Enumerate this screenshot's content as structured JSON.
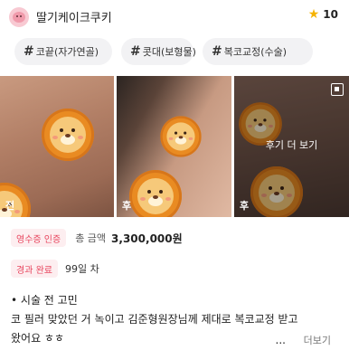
{
  "header": {
    "username": "딸기케이크쿠키",
    "rating": "10",
    "star_icon": "star-icon",
    "avatar_icon": "strawberry-cake-avatar-icon"
  },
  "tags": [
    {
      "hash": "#",
      "label": "코끝(자가연골)"
    },
    {
      "hash": "#",
      "label": "콧대(보형물)"
    },
    {
      "hash": "#",
      "label": "복코교정(수술)"
    }
  ],
  "photos": [
    {
      "label": "전",
      "sticker": "lion-sticker-icon"
    },
    {
      "label": "후",
      "sticker": "lion-sticker-icon"
    },
    {
      "label": "후",
      "overlay_text": "후기 더 보기",
      "sticker": "lion-sticker-icon"
    }
  ],
  "receipt": {
    "badge": "영수증 인증",
    "label": "총 금액",
    "value": "3,300,000원"
  },
  "progress": {
    "badge": "경과 완료",
    "days": "99일 차"
  },
  "review": {
    "bullet": "•",
    "line1": "시술 전 고민",
    "line2": "코 필러 맞았던 거 녹이고 김준형원장님께 제대로 복코교정 받고",
    "line3": "왔어요 ㅎㅎ",
    "ellipsis": "...",
    "more": "더보기"
  },
  "colors": {
    "accent": "#e8475f",
    "badge_bg": "#fdeef0",
    "tag_bg": "#f2f2f4",
    "star": "#f5b301"
  }
}
